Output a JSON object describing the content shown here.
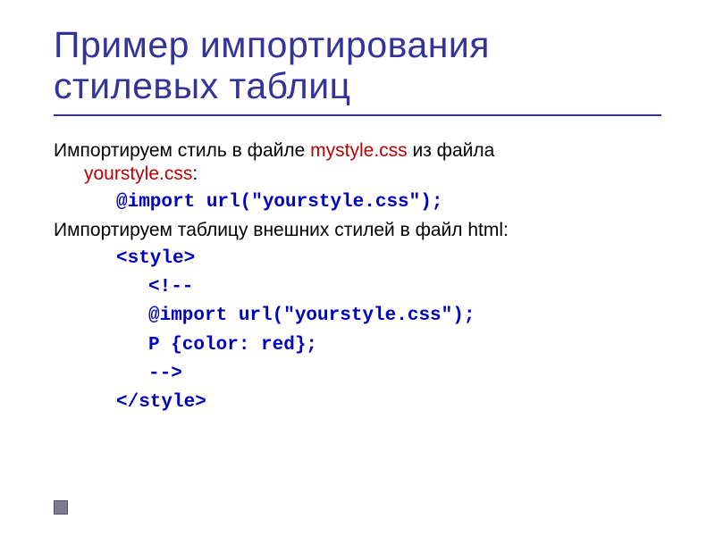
{
  "title": "Пример импортирования стилевых таблиц",
  "body": {
    "p1_a": "Импортируем стиль в файле ",
    "p1_file1": "mystyle.css",
    "p1_b": " из файла ",
    "p1_file2": "yourstyle.css",
    "p1_c": ":",
    "code1": "@import url(\"yourstyle.css\");",
    "p2": "Импортируем таблицу внешних стилей в файл html:",
    "code2_l1": "<style>",
    "code2_l2": "<!--",
    "code2_l3": "@import url(\"yourstyle.css\");",
    "code2_l4": "P {color: red};",
    "code2_l5": "-->",
    "code2_l6": "</style>"
  }
}
